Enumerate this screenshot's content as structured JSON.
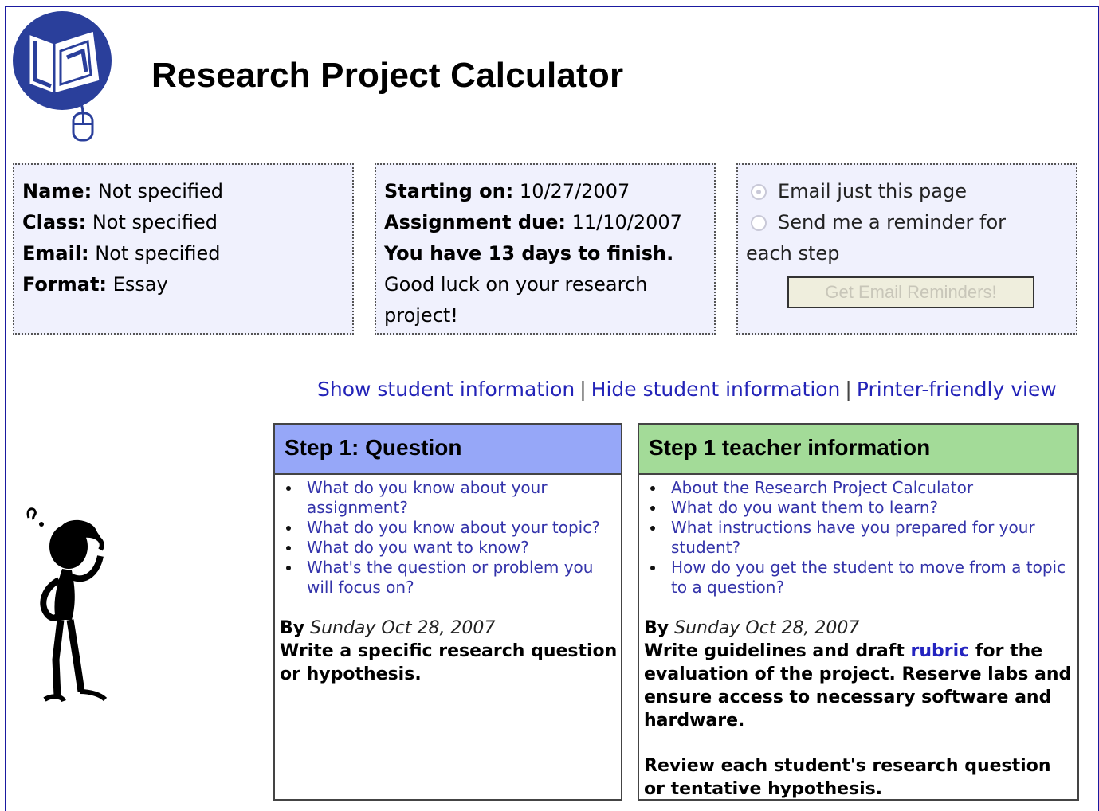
{
  "header": {
    "title": "Research Project Calculator"
  },
  "student_box": {
    "name_label": "Name:",
    "name_value": "Not specified",
    "class_label": "Class:",
    "class_value": "Not specified",
    "email_label": "Email:",
    "email_value": "Not specified",
    "format_label": "Format:",
    "format_value": "Essay"
  },
  "date_box": {
    "start_label": "Starting on:",
    "start_value": "10/27/2007",
    "due_label": "Assignment due:",
    "due_value": "11/10/2007",
    "days_text": "You have 13 days to finish.",
    "luck_text": "Good luck on your research project!"
  },
  "email_box": {
    "option1": "Email just this page",
    "option2_line1": "Send me a reminder for",
    "option2_line2": "each step",
    "selected": "option1",
    "button_label": "Get Email Reminders!"
  },
  "links": {
    "show": "Show student information",
    "hide": "Hide student information",
    "printer": "Printer-friendly view",
    "separator": "|"
  },
  "step_panel": {
    "heading": "Step 1: Question",
    "items": [
      "What do you know about your assignment?",
      "What do you know about your topic?",
      "What do you want to know?",
      "What's the question or problem you will focus on?"
    ],
    "by_label": "By",
    "date": "Sunday Oct 28, 2007",
    "task": "Write a specific research question or hypothesis."
  },
  "teacher_panel": {
    "heading": "Step 1 teacher information",
    "items": [
      "About the Research Project Calculator",
      "What do you want them to learn?",
      "What instructions have you prepared for your student?",
      "How do you get the student to move from a topic to a question?"
    ],
    "by_label": "By",
    "date": "Sunday Oct 28, 2007",
    "task_before_link": "Write guidelines and draft",
    "task_link": "rubric",
    "task_after_link": "for the evaluation of the project. Reserve labs and ensure access to necessary software and hardware.",
    "task2": "Review each student's research question or tentative hypothesis."
  },
  "colors": {
    "step_header": "#96a7f8",
    "teacher_header": "#a3db98",
    "link": "#2323b8",
    "info_bg": "#f0f1fd"
  }
}
